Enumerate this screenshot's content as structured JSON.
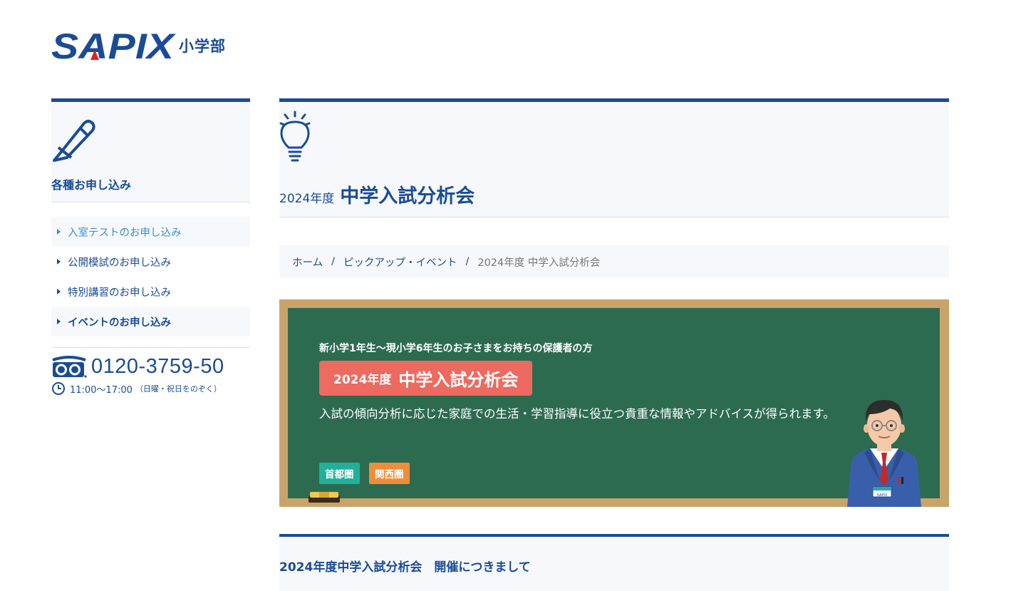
{
  "header": {
    "logo_text": "SAPIX",
    "logo_sub": "小学部"
  },
  "sidebar": {
    "title": "各種お申し込み",
    "items": [
      {
        "label": "入室テストのお申し込み"
      },
      {
        "label": "公開模試のお申し込み"
      },
      {
        "label": "特別講習のお申し込み"
      },
      {
        "label": "イベントのお申し込み"
      }
    ],
    "phone": "0120-3759-50",
    "hours": "11:00〜17:00",
    "hours_note": "（日曜・祝日をのぞく）"
  },
  "page": {
    "year": "2024年度",
    "title": "中学入試分析会"
  },
  "breadcrumb": {
    "home": "ホーム",
    "category": "ピックアップ・イベント",
    "current": "2024年度 中学入試分析会"
  },
  "banner": {
    "audience": "新小学1年生〜現小学6年生のお子さまをお持ちの保護者の方",
    "year": "2024年度",
    "title": "中学入試分析会",
    "description": "入試の傾向分析に応じた家庭での生活・学習指導に役立つ貴重な情報やアドバイスが得られます。",
    "tags": [
      "首都圏",
      "関西圏"
    ],
    "badge_text": "SAPIX"
  },
  "section": {
    "title": "2024年度中学入試分析会　開催につきまして"
  },
  "colors": {
    "brand_blue": "#1a4c96",
    "board_green": "#2d6b51",
    "pill_red": "#ec6a60",
    "tag_green": "#22b09a",
    "tag_orange": "#f08d3c"
  }
}
